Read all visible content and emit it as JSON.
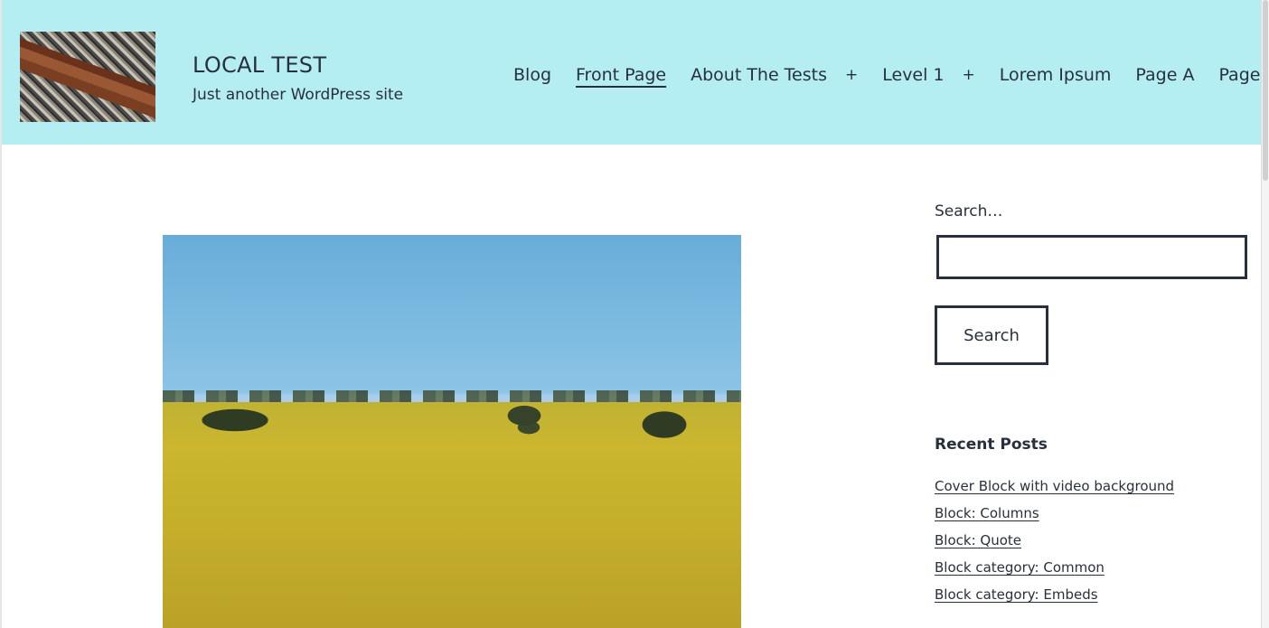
{
  "site": {
    "title": "LOCAL TEST",
    "description": "Just another WordPress site"
  },
  "nav": {
    "items": [
      {
        "label": "Blog"
      },
      {
        "label": "Front Page",
        "current": true
      },
      {
        "label": "About The Tests",
        "has_submenu": true
      },
      {
        "label": "Level 1",
        "has_submenu": true
      },
      {
        "label": "Lorem Ipsum"
      },
      {
        "label": "Page A"
      },
      {
        "label": "Page B"
      }
    ],
    "submenu_toggle": "+"
  },
  "hero_image": {
    "subject": "canola field under blue sky"
  },
  "sidebar": {
    "search_label": "Search…",
    "search_value": "",
    "search_button": "Search",
    "recent_posts_title": "Recent Posts",
    "recent_posts": [
      "Cover Block with video background",
      "Block: Columns",
      "Block: Quote",
      "Block category: Common",
      "Block category: Embeds"
    ]
  },
  "colors": {
    "header_bg": "#b4eef3",
    "text": "#28303d"
  }
}
